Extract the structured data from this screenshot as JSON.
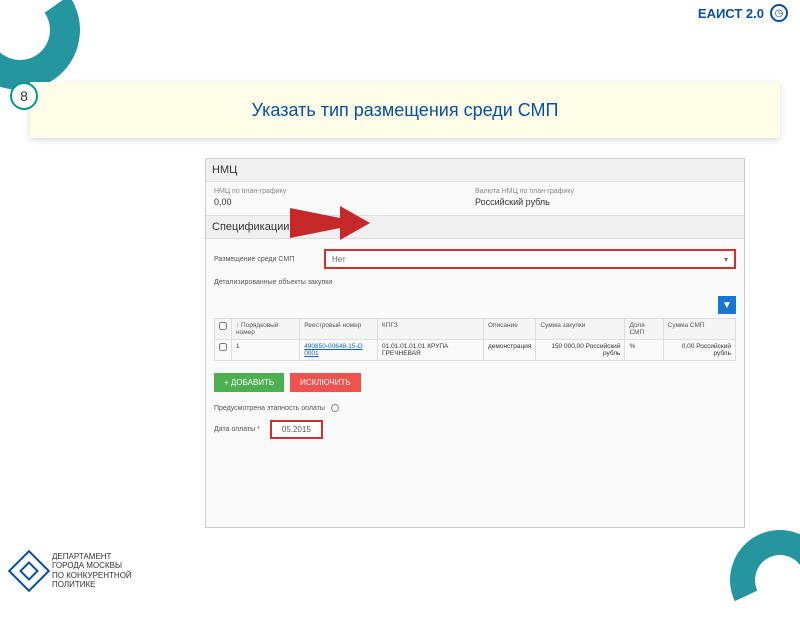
{
  "header": {
    "brand": "ЕАИСТ 2.0"
  },
  "step": {
    "number": "8"
  },
  "banner": {
    "title": "Указать тип размещения среди СМП"
  },
  "panel": {
    "nmc_section": "НМЦ",
    "nmc_label": "НМЦ по план-графику",
    "nmc_value": "0,00",
    "currency_label": "Валюта НМЦ по план-графику",
    "currency_value": "Российский рубль",
    "spec_section": "Спецификации",
    "smp_label": "Размещение среди СМП",
    "smp_value": "Нет",
    "detail_label": "Детализированные объекты закупки",
    "table": {
      "headers": [
        "",
        "↑ Порядковый номер",
        "Реестровый номер",
        "КПГЗ",
        "Описание",
        "Сумма закупки",
        "Доля СМП",
        "Сумма СМП"
      ],
      "row": {
        "num": "1",
        "reg": "490850-00648-15-O 0001",
        "kpgz": "01.01.01.01.01 КРУПА ГРЕЧНЕВАЯ",
        "desc": "демонстрация",
        "sum": "150 000,00 Российский рубль",
        "share": "%",
        "smp_sum": "0,00 Российский рубль"
      }
    },
    "btn_add": "+ добавить",
    "btn_del": "исключить",
    "pay_stage": "Предусмотрена этапность оплаты",
    "date_label": "Дата оплаты *",
    "date_value": "05.2015"
  },
  "footer": {
    "line1": "ДЕПАРТАМЕНТ",
    "line2": "ГОРОДА МОСКВЫ",
    "line3": "ПО КОНКУРЕНТНОЙ",
    "line4": "ПОЛИТИКЕ"
  }
}
